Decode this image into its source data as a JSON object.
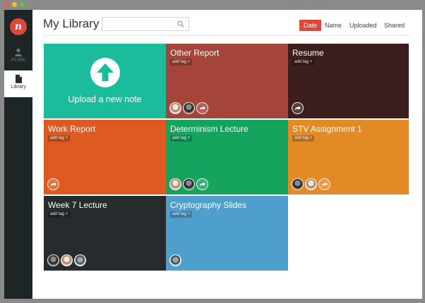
{
  "window": {
    "controls": [
      "close",
      "minimize",
      "maximize"
    ]
  },
  "sidebar": {
    "logo_icon": "notes-logo-icon",
    "items": [
      {
        "label": "Profile",
        "icon": "person-icon",
        "active": false
      },
      {
        "label": "Library",
        "icon": "document-icon",
        "active": true
      }
    ]
  },
  "header": {
    "title": "My Library",
    "search": {
      "value": "",
      "placeholder": "",
      "icon": "search-icon"
    },
    "sorts": [
      {
        "label": "Date",
        "active": true
      },
      {
        "label": "Name",
        "active": false
      },
      {
        "label": "Uploaded",
        "active": false
      },
      {
        "label": "Shared",
        "active": false
      }
    ]
  },
  "upload": {
    "label": "Upload a new note",
    "icon": "upload-arrow-icon",
    "color": "#1abc9c"
  },
  "notes": [
    {
      "title": "Other Report",
      "tag": "add tag +",
      "color": "#a5443a",
      "avatars": [
        "a1",
        "a2"
      ]
    },
    {
      "title": "Resume",
      "tag": "add tag +",
      "color": "#3d1e1f",
      "avatars": []
    },
    {
      "title": "Work Report",
      "tag": "add tag +",
      "color": "#dd5b22",
      "avatars": []
    },
    {
      "title": "Determinism Lecture",
      "tag": "add tag +",
      "color": "#14a45e",
      "avatars": [
        "a1",
        "a2"
      ]
    },
    {
      "title": "STV Assignment 1",
      "tag": "add tag +",
      "color": "#e48a24",
      "avatars": [
        "a2",
        "a1"
      ]
    },
    {
      "title": "Week 7 Lecture",
      "tag": "add tag +",
      "color": "#262b2d",
      "avatars": [
        "a2",
        "a1",
        "a3"
      ]
    },
    {
      "title": "Cryptography Slides",
      "tag": "add tag +",
      "color": "#4f9fcc",
      "avatars": [
        "a3"
      ]
    }
  ],
  "share_icon": "share-icon"
}
